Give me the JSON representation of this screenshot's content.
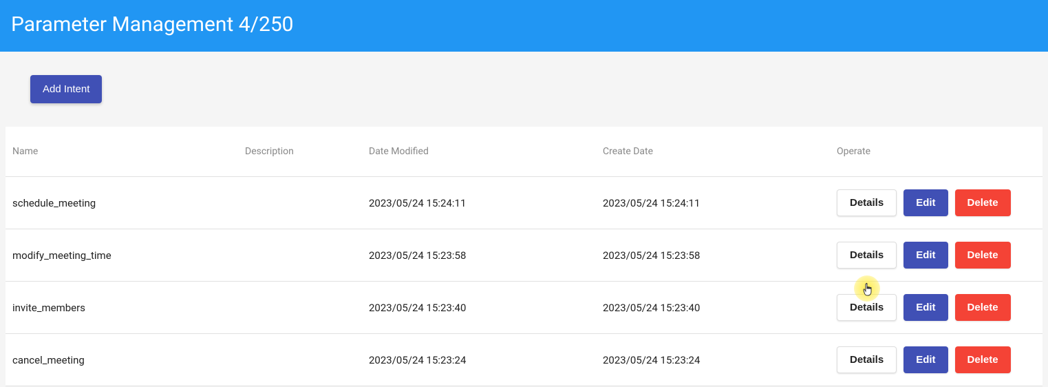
{
  "header": {
    "title": "Parameter Management 4/250"
  },
  "toolbar": {
    "add_label": "Add Intent"
  },
  "columns": {
    "name": "Name",
    "description": "Description",
    "date_modified": "Date Modified",
    "create_date": "Create Date",
    "operate": "Operate"
  },
  "rows": [
    {
      "name": "schedule_meeting",
      "description": "",
      "date_modified": "2023/05/24 15:24:11",
      "create_date": "2023/05/24 15:24:11"
    },
    {
      "name": "modify_meeting_time",
      "description": "",
      "date_modified": "2023/05/24 15:23:58",
      "create_date": "2023/05/24 15:23:58"
    },
    {
      "name": "invite_members",
      "description": "",
      "date_modified": "2023/05/24 15:23:40",
      "create_date": "2023/05/24 15:23:40"
    },
    {
      "name": "cancel_meeting",
      "description": "",
      "date_modified": "2023/05/24 15:23:24",
      "create_date": "2023/05/24 15:23:24"
    }
  ],
  "buttons": {
    "details": "Details",
    "edit": "Edit",
    "delete": "Delete"
  }
}
